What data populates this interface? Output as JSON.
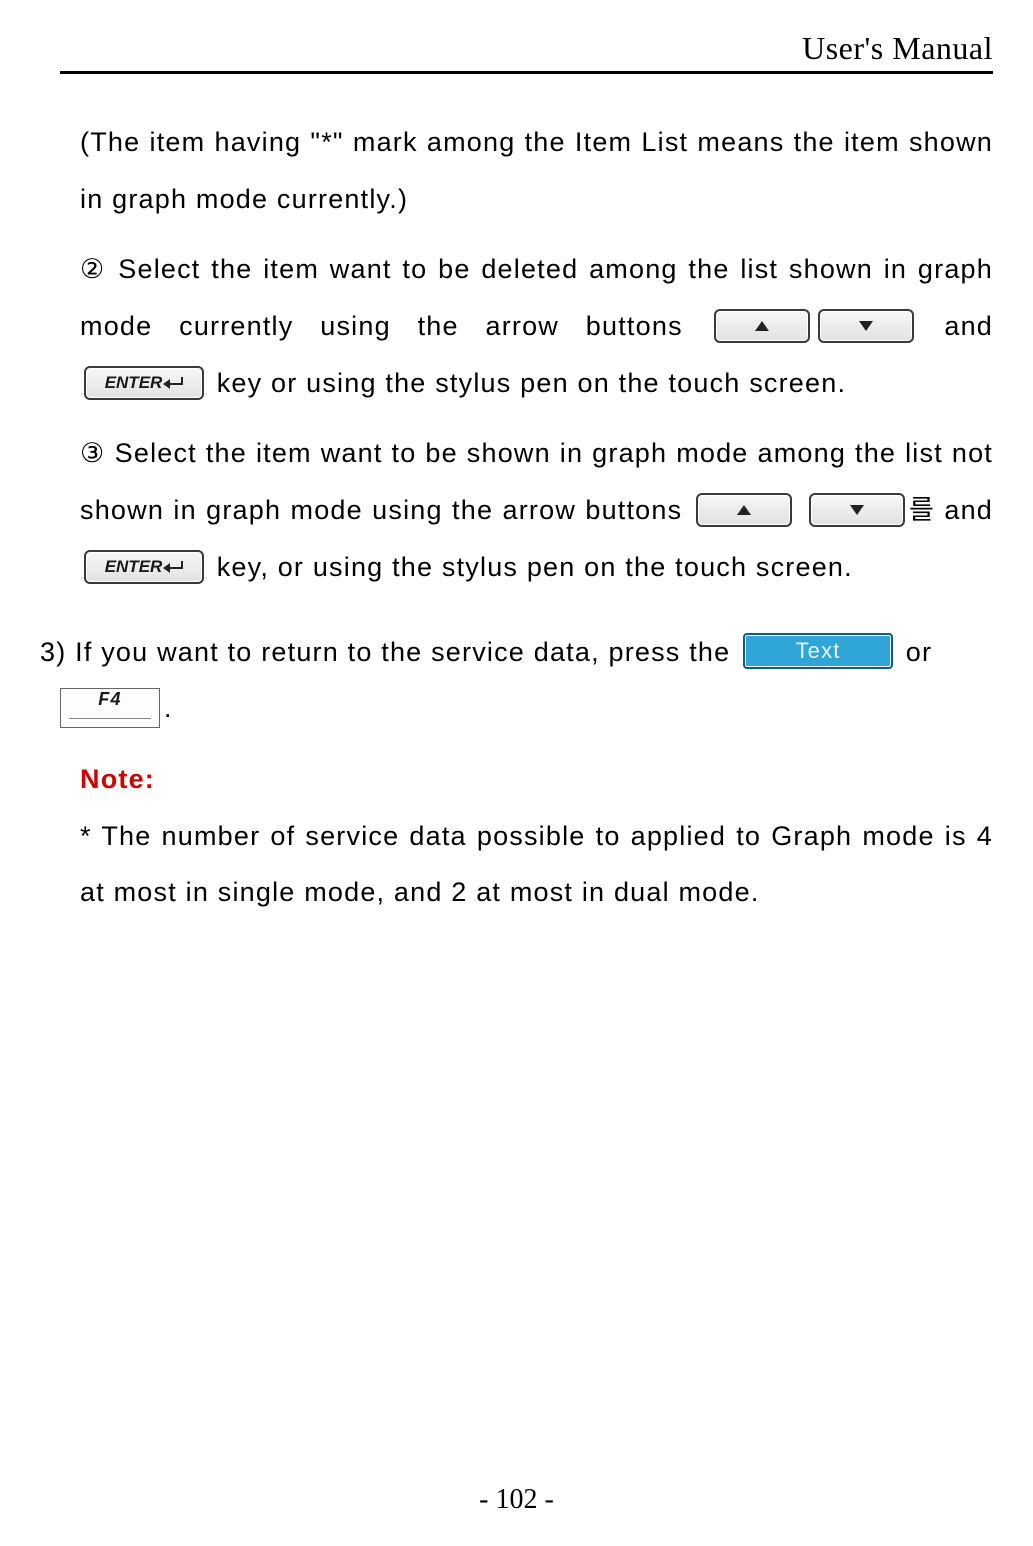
{
  "header": {
    "title": "User's Manual"
  },
  "footer": {
    "page": "- 102 -"
  },
  "body": {
    "p1": "(The item having \"*\" mark among the Item List means the item shown in graph mode currently.)",
    "step2_no": "②",
    "step2a": "Select the item want to be deleted among the list shown in graph mode currently using the arrow buttons",
    "step2b": "and",
    "step2c": "key or using the stylus pen on the touch screen.",
    "step3_no": "③",
    "step3a": "Select the item want to be shown in graph mode among the list not shown in graph mode using the arrow buttons",
    "step3b": "를 and",
    "step3c": "key, or using the stylus pen on the touch screen.",
    "item3_no": "3)",
    "item3a": "If you want to return to the service data, press the",
    "item3b": "or",
    "item3c": ".",
    "note_label": "Note:",
    "note_text": "* The number of service data possible to applied to Graph mode is 4 at most in single mode, and 2 at most in dual mode."
  },
  "keys": {
    "enter": "ENTER",
    "text": "Text",
    "f4": "F4"
  }
}
